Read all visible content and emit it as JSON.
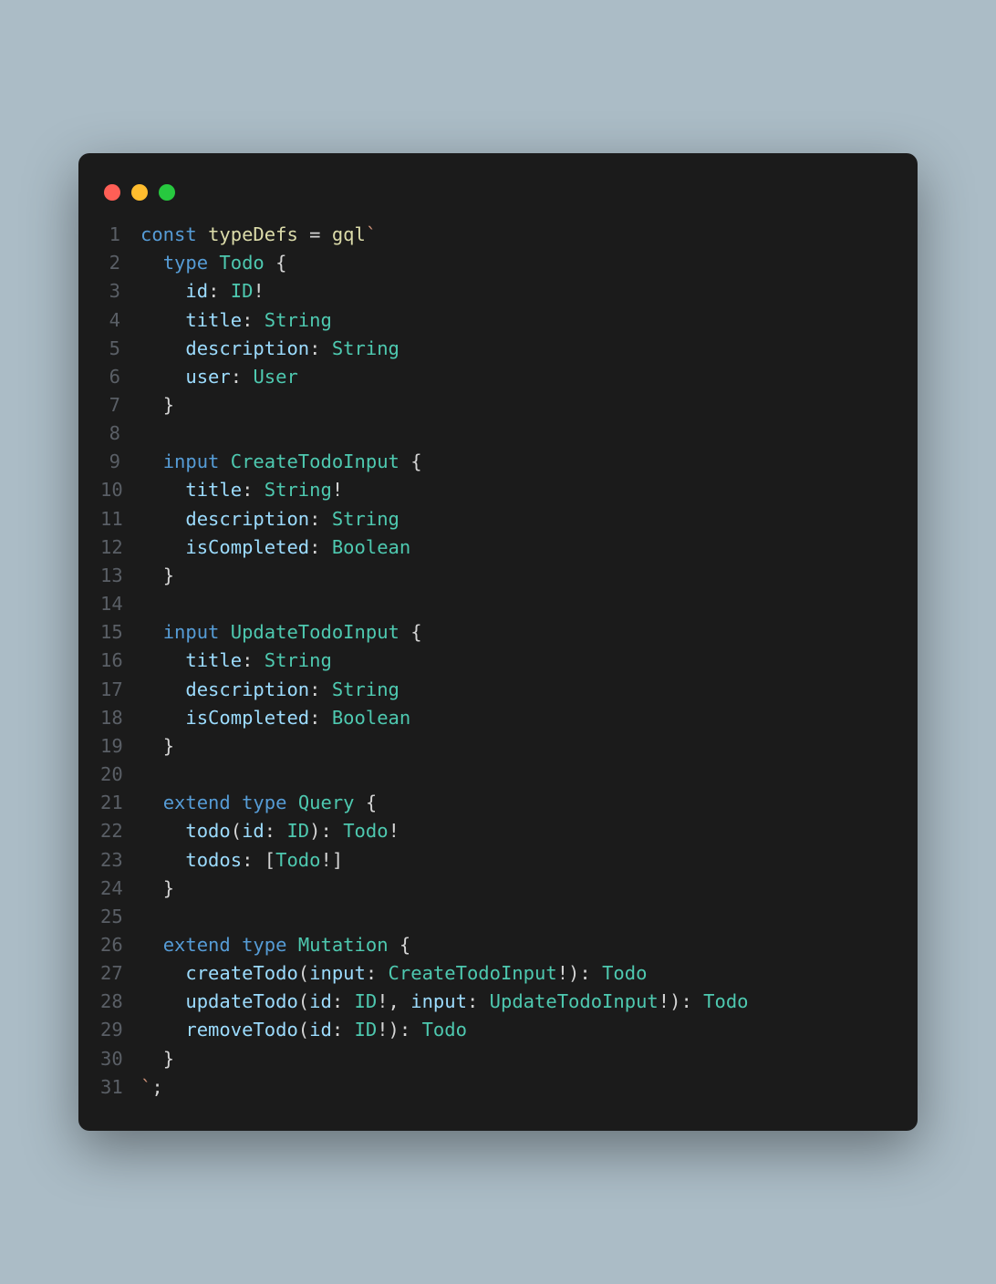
{
  "traffic": {
    "red": "red",
    "yellow": "yellow",
    "green": "green"
  },
  "lines": [
    {
      "n": "1",
      "tokens": [
        [
          "kw",
          "const"
        ],
        [
          "op",
          " "
        ],
        [
          "fn",
          "typeDefs"
        ],
        [
          "op",
          " = "
        ],
        [
          "fn",
          "gql"
        ],
        [
          "str",
          "`"
        ]
      ]
    },
    {
      "n": "2",
      "tokens": [
        [
          "str",
          "  "
        ],
        [
          "kw",
          "type"
        ],
        [
          "str",
          " "
        ],
        [
          "typ",
          "Todo"
        ],
        [
          "str",
          " "
        ],
        [
          "pun",
          "{"
        ]
      ]
    },
    {
      "n": "3",
      "tokens": [
        [
          "str",
          "    "
        ],
        [
          "fld",
          "id"
        ],
        [
          "pun",
          ":"
        ],
        [
          "str",
          " "
        ],
        [
          "typ",
          "ID"
        ],
        [
          "pun",
          "!"
        ]
      ]
    },
    {
      "n": "4",
      "tokens": [
        [
          "str",
          "    "
        ],
        [
          "fld",
          "title"
        ],
        [
          "pun",
          ":"
        ],
        [
          "str",
          " "
        ],
        [
          "typ",
          "String"
        ]
      ]
    },
    {
      "n": "5",
      "tokens": [
        [
          "str",
          "    "
        ],
        [
          "fld",
          "description"
        ],
        [
          "pun",
          ":"
        ],
        [
          "str",
          " "
        ],
        [
          "typ",
          "String"
        ]
      ]
    },
    {
      "n": "6",
      "tokens": [
        [
          "str",
          "    "
        ],
        [
          "fld",
          "user"
        ],
        [
          "pun",
          ":"
        ],
        [
          "str",
          " "
        ],
        [
          "typ",
          "User"
        ]
      ]
    },
    {
      "n": "7",
      "tokens": [
        [
          "str",
          "  "
        ],
        [
          "pun",
          "}"
        ]
      ]
    },
    {
      "n": "8",
      "tokens": [
        [
          "str",
          ""
        ]
      ]
    },
    {
      "n": "9",
      "tokens": [
        [
          "str",
          "  "
        ],
        [
          "kw",
          "input"
        ],
        [
          "str",
          " "
        ],
        [
          "typ",
          "CreateTodoInput"
        ],
        [
          "str",
          " "
        ],
        [
          "pun",
          "{"
        ]
      ]
    },
    {
      "n": "10",
      "tokens": [
        [
          "str",
          "    "
        ],
        [
          "fld",
          "title"
        ],
        [
          "pun",
          ":"
        ],
        [
          "str",
          " "
        ],
        [
          "typ",
          "String"
        ],
        [
          "pun",
          "!"
        ]
      ]
    },
    {
      "n": "11",
      "tokens": [
        [
          "str",
          "    "
        ],
        [
          "fld",
          "description"
        ],
        [
          "pun",
          ":"
        ],
        [
          "str",
          " "
        ],
        [
          "typ",
          "String"
        ]
      ]
    },
    {
      "n": "12",
      "tokens": [
        [
          "str",
          "    "
        ],
        [
          "fld",
          "isCompleted"
        ],
        [
          "pun",
          ":"
        ],
        [
          "str",
          " "
        ],
        [
          "typ",
          "Boolean"
        ]
      ]
    },
    {
      "n": "13",
      "tokens": [
        [
          "str",
          "  "
        ],
        [
          "pun",
          "}"
        ]
      ]
    },
    {
      "n": "14",
      "tokens": [
        [
          "str",
          ""
        ]
      ]
    },
    {
      "n": "15",
      "tokens": [
        [
          "str",
          "  "
        ],
        [
          "kw",
          "input"
        ],
        [
          "str",
          " "
        ],
        [
          "typ",
          "UpdateTodoInput"
        ],
        [
          "str",
          " "
        ],
        [
          "pun",
          "{"
        ]
      ]
    },
    {
      "n": "16",
      "tokens": [
        [
          "str",
          "    "
        ],
        [
          "fld",
          "title"
        ],
        [
          "pun",
          ":"
        ],
        [
          "str",
          " "
        ],
        [
          "typ",
          "String"
        ]
      ]
    },
    {
      "n": "17",
      "tokens": [
        [
          "str",
          "    "
        ],
        [
          "fld",
          "description"
        ],
        [
          "pun",
          ":"
        ],
        [
          "str",
          " "
        ],
        [
          "typ",
          "String"
        ]
      ]
    },
    {
      "n": "18",
      "tokens": [
        [
          "str",
          "    "
        ],
        [
          "fld",
          "isCompleted"
        ],
        [
          "pun",
          ":"
        ],
        [
          "str",
          " "
        ],
        [
          "typ",
          "Boolean"
        ]
      ]
    },
    {
      "n": "19",
      "tokens": [
        [
          "str",
          "  "
        ],
        [
          "pun",
          "}"
        ]
      ]
    },
    {
      "n": "20",
      "tokens": [
        [
          "str",
          ""
        ]
      ]
    },
    {
      "n": "21",
      "tokens": [
        [
          "str",
          "  "
        ],
        [
          "kw",
          "extend"
        ],
        [
          "str",
          " "
        ],
        [
          "kw",
          "type"
        ],
        [
          "str",
          " "
        ],
        [
          "typ",
          "Query"
        ],
        [
          "str",
          " "
        ],
        [
          "pun",
          "{"
        ]
      ]
    },
    {
      "n": "22",
      "tokens": [
        [
          "str",
          "    "
        ],
        [
          "fld",
          "todo"
        ],
        [
          "pun",
          "("
        ],
        [
          "fld",
          "id"
        ],
        [
          "pun",
          ":"
        ],
        [
          "str",
          " "
        ],
        [
          "typ",
          "ID"
        ],
        [
          "pun",
          "):"
        ],
        [
          "str",
          " "
        ],
        [
          "typ",
          "Todo"
        ],
        [
          "pun",
          "!"
        ]
      ]
    },
    {
      "n": "23",
      "tokens": [
        [
          "str",
          "    "
        ],
        [
          "fld",
          "todos"
        ],
        [
          "pun",
          ":"
        ],
        [
          "str",
          " "
        ],
        [
          "pun",
          "["
        ],
        [
          "typ",
          "Todo"
        ],
        [
          "pun",
          "!]"
        ]
      ]
    },
    {
      "n": "24",
      "tokens": [
        [
          "str",
          "  "
        ],
        [
          "pun",
          "}"
        ]
      ]
    },
    {
      "n": "25",
      "tokens": [
        [
          "str",
          ""
        ]
      ]
    },
    {
      "n": "26",
      "tokens": [
        [
          "str",
          "  "
        ],
        [
          "kw",
          "extend"
        ],
        [
          "str",
          " "
        ],
        [
          "kw",
          "type"
        ],
        [
          "str",
          " "
        ],
        [
          "typ",
          "Mutation"
        ],
        [
          "str",
          " "
        ],
        [
          "pun",
          "{"
        ]
      ]
    },
    {
      "n": "27",
      "tokens": [
        [
          "str",
          "    "
        ],
        [
          "fld",
          "createTodo"
        ],
        [
          "pun",
          "("
        ],
        [
          "fld",
          "input"
        ],
        [
          "pun",
          ":"
        ],
        [
          "str",
          " "
        ],
        [
          "typ",
          "CreateTodoInput"
        ],
        [
          "pun",
          "!):"
        ],
        [
          "str",
          " "
        ],
        [
          "typ",
          "Todo"
        ]
      ]
    },
    {
      "n": "28",
      "tokens": [
        [
          "str",
          "    "
        ],
        [
          "fld",
          "updateTodo"
        ],
        [
          "pun",
          "("
        ],
        [
          "fld",
          "id"
        ],
        [
          "pun",
          ":"
        ],
        [
          "str",
          " "
        ],
        [
          "typ",
          "ID"
        ],
        [
          "pun",
          "!,"
        ],
        [
          "str",
          " "
        ],
        [
          "fld",
          "input"
        ],
        [
          "pun",
          ":"
        ],
        [
          "str",
          " "
        ],
        [
          "typ",
          "UpdateTodoInput"
        ],
        [
          "pun",
          "!):"
        ],
        [
          "str",
          " "
        ],
        [
          "typ",
          "Todo"
        ]
      ]
    },
    {
      "n": "29",
      "tokens": [
        [
          "str",
          "    "
        ],
        [
          "fld",
          "removeTodo"
        ],
        [
          "pun",
          "("
        ],
        [
          "fld",
          "id"
        ],
        [
          "pun",
          ":"
        ],
        [
          "str",
          " "
        ],
        [
          "typ",
          "ID"
        ],
        [
          "pun",
          "!):"
        ],
        [
          "str",
          " "
        ],
        [
          "typ",
          "Todo"
        ]
      ]
    },
    {
      "n": "30",
      "tokens": [
        [
          "str",
          "  "
        ],
        [
          "pun",
          "}"
        ]
      ]
    },
    {
      "n": "31",
      "tokens": [
        [
          "str",
          "`"
        ],
        [
          "pun",
          ";"
        ]
      ]
    }
  ]
}
